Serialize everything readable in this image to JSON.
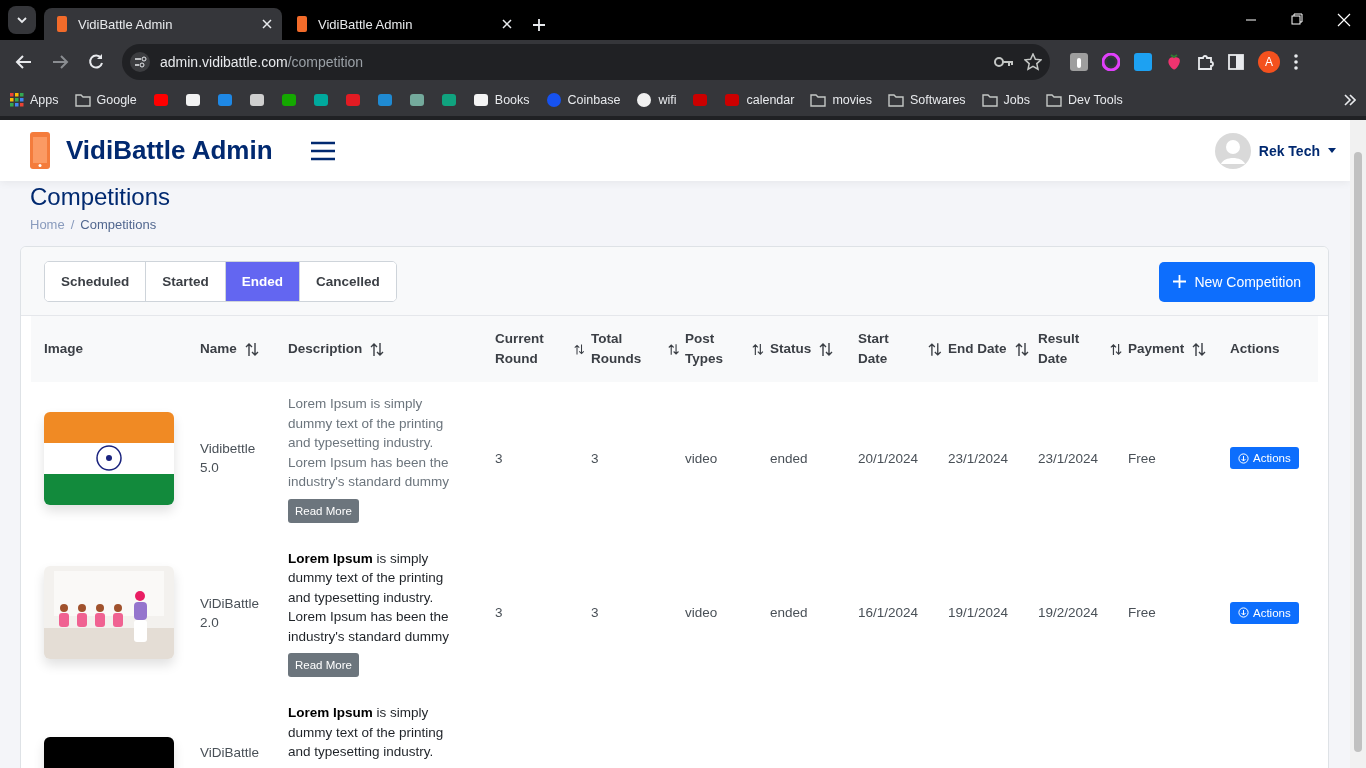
{
  "browser": {
    "tabs": [
      {
        "title": "VidiBattle Admin",
        "selected": true
      },
      {
        "title": "VidiBattle Admin",
        "selected": false
      }
    ],
    "url_host": "admin.vidibattle.com",
    "url_path": "/competition",
    "profile_initial": "A",
    "bookmarks": [
      {
        "kind": "apps",
        "label": "Apps"
      },
      {
        "kind": "folder",
        "label": "Google"
      },
      {
        "kind": "site",
        "color": "#ff0000"
      },
      {
        "kind": "site",
        "color": "#f2f2f2"
      },
      {
        "kind": "site",
        "color": "#1e88e5"
      },
      {
        "kind": "site",
        "color": "#cfcfcf"
      },
      {
        "kind": "site",
        "color": "#14a800"
      },
      {
        "kind": "site",
        "color": "#00a99d"
      },
      {
        "kind": "site",
        "color": "#e31b23"
      },
      {
        "kind": "site",
        "color": "#1f8ad2"
      },
      {
        "kind": "site",
        "color": "#74aa9c"
      },
      {
        "kind": "site",
        "color": "#10a37f"
      },
      {
        "kind": "site",
        "color": "#f4f4f4",
        "label": "Books"
      },
      {
        "kind": "globe",
        "color": "#1652f0",
        "label": "Coinbase"
      },
      {
        "kind": "globe",
        "color": "#f0f0f0",
        "label": "wifi"
      },
      {
        "kind": "site",
        "color": "#cc0000"
      },
      {
        "kind": "site",
        "color": "#cc0000",
        "label": "calendar"
      },
      {
        "kind": "folder",
        "label": "movies"
      },
      {
        "kind": "folder",
        "label": "Softwares"
      },
      {
        "kind": "folder",
        "label": "Jobs"
      },
      {
        "kind": "folder",
        "label": "Dev Tools"
      }
    ]
  },
  "app": {
    "brand": "VidiBattle Admin",
    "user": "Rek Tech"
  },
  "page": {
    "title": "Competitions",
    "breadcrumb_separator": "/",
    "breadcrumb": [
      {
        "label": "Home",
        "current": false
      },
      {
        "label": "Competitions",
        "current": true
      }
    ]
  },
  "filter_tabs": [
    {
      "label": "Scheduled",
      "selected": false
    },
    {
      "label": "Started",
      "selected": false
    },
    {
      "label": "Ended",
      "selected": true
    },
    {
      "label": "Cancelled",
      "selected": false
    }
  ],
  "new_button": "New Competition",
  "table": {
    "columns": [
      {
        "label": "Image",
        "sortable": false
      },
      {
        "label": "Name",
        "sortable": true
      },
      {
        "label": "Description",
        "sortable": true
      },
      {
        "label": "Current Round",
        "sortable": true
      },
      {
        "label": "Total Rounds",
        "sortable": true
      },
      {
        "label": "Post Types",
        "sortable": true
      },
      {
        "label": "Status",
        "sortable": true
      },
      {
        "label": "Start Date",
        "sortable": true
      },
      {
        "label": "End Date",
        "sortable": true
      },
      {
        "label": "Result Date",
        "sortable": true
      },
      {
        "label": "Payment",
        "sortable": true
      },
      {
        "label": "Actions",
        "sortable": false
      }
    ],
    "rows": [
      {
        "name": "Vidibettle 5.0",
        "description": "Lorem Ipsum is simply dummy text of the printing and typesetting industry. Lorem Ipsum has been the industry's standard dummy",
        "muted": true,
        "read_more": "Read More",
        "cells": [
          "3",
          "3",
          "video",
          "ended",
          "20/1/2024",
          "23/1/2024",
          "23/1/2024",
          "Free"
        ],
        "actions": "Actions"
      },
      {
        "name": "ViDiBattle 2.0",
        "description": "**Lorem Ipsum** is simply dummy text of the printing and typesetting industry. Lorem Ipsum has been the industry's standard dummy",
        "muted": false,
        "read_more": "Read More",
        "cells": [
          "3",
          "3",
          "video",
          "ended",
          "16/1/2024",
          "19/1/2024",
          "19/2/2024",
          "Free"
        ],
        "actions": "Actions"
      },
      {
        "name": "ViDiBattle",
        "description": "**Lorem Ipsum** is simply dummy text of the printing and typesetting industry.",
        "muted": false
      }
    ]
  }
}
